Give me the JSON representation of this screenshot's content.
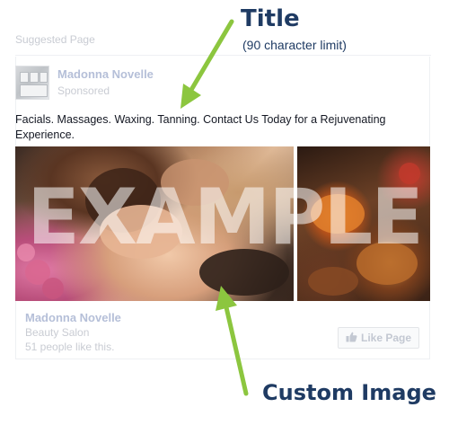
{
  "suggested_label": "Suggested Page",
  "post": {
    "page_name": "Madonna Novelle",
    "sponsored_label": "Sponsored",
    "text": "Facials. Massages. Waxing. Tanning. Contact Us Today for a Rejuvenating Experience.",
    "watermark": "EXAMPLE"
  },
  "footer": {
    "page_name": "Madonna Novelle",
    "category": "Beauty Salon",
    "likes": "51 people like this.",
    "like_button_label": "Like Page"
  },
  "annotations": {
    "title": "Title",
    "title_limit": "(90 character limit)",
    "custom_image": "Custom Image",
    "arrow_color": "#8cc63f",
    "text_color": "#1f3b63"
  },
  "icons": {
    "like": "thumbs-up-icon",
    "avatar": "building-photo"
  }
}
